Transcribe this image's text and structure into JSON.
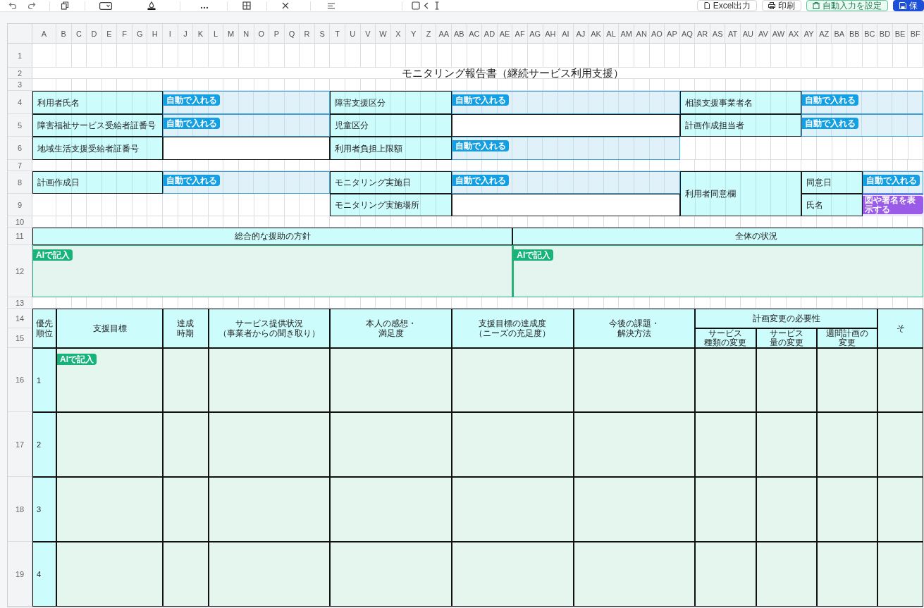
{
  "toolbar": {
    "buttons": [
      {
        "kind": "outline",
        "label": "Excel出力"
      },
      {
        "kind": "outline",
        "label": "印刷"
      },
      {
        "kind": "accent",
        "label": "自動入力を設定"
      },
      {
        "kind": "primary",
        "label": "保"
      }
    ]
  },
  "sheet": {
    "column_headers": [
      "A",
      "B",
      "C",
      "D",
      "E",
      "F",
      "G",
      "H",
      "I",
      "J",
      "K",
      "L",
      "M",
      "N",
      "O",
      "P",
      "Q",
      "R",
      "S",
      "T",
      "U",
      "V",
      "W",
      "X",
      "Y",
      "Z",
      "AA",
      "AB",
      "AC",
      "AD",
      "AE",
      "AF",
      "AG",
      "AH",
      "AI",
      "AJ",
      "AK",
      "AL",
      "AM",
      "AN",
      "AO",
      "AP",
      "AQ",
      "AR",
      "AS",
      "AT",
      "AU",
      "AV",
      "AW",
      "AX",
      "AY",
      "AZ",
      "BA",
      "BB",
      "BC",
      "BD",
      "BE",
      "BF"
    ],
    "row_headers": [
      "1",
      "2",
      "3",
      "4",
      "5",
      "6",
      "7",
      "8",
      "9",
      "10",
      "11",
      "12",
      "13",
      "14",
      "15",
      "16",
      "17",
      "18",
      "19"
    ],
    "title": "モニタリング報告書（継続サービス利用支援）",
    "info_rows": [
      [
        {
          "kind": "label",
          "text": "利用者氏名"
        },
        {
          "kind": "auto",
          "button": "自動で入れる"
        },
        {
          "kind": "label",
          "text": "障害支援区分"
        },
        {
          "kind": "auto",
          "button": "自動で入れる"
        },
        {
          "kind": "label",
          "text": "相談支援事業者名"
        },
        {
          "kind": "auto",
          "button": "自動で入れる"
        }
      ],
      [
        {
          "kind": "label",
          "text": "障害福祉サービス受給者証番号"
        },
        {
          "kind": "auto",
          "button": "自動で入れる"
        },
        {
          "kind": "label",
          "text": "児童区分"
        },
        {
          "kind": "blank"
        },
        {
          "kind": "label",
          "text": "計画作成担当者"
        },
        {
          "kind": "auto",
          "button": "自動で入れる"
        }
      ],
      [
        {
          "kind": "label",
          "text": "地域生活支援受給者証番号"
        },
        {
          "kind": "blank"
        },
        {
          "kind": "label",
          "text": "利用者負担上限額"
        },
        {
          "kind": "auto",
          "button": "自動で入れる"
        }
      ],
      [
        {
          "kind": "label",
          "text": "計画作成日"
        },
        {
          "kind": "auto",
          "button": "自動で入れる"
        },
        {
          "kind": "label",
          "text": "モニタリング実施日"
        },
        {
          "kind": "auto",
          "button": "自動で入れる"
        },
        {
          "kind": "label",
          "text": "利用者同意欄"
        },
        {
          "kind": "label",
          "text": "同意日"
        },
        {
          "kind": "auto",
          "button": "自動で入れる"
        }
      ],
      [
        {
          "kind": "label",
          "text": "モニタリング実施場所"
        },
        {
          "kind": "blank"
        },
        {
          "kind": "label",
          "text": "氏名"
        },
        {
          "kind": "signature",
          "button": "図や署名を表示する"
        }
      ]
    ],
    "summary_sections": [
      {
        "title": "総合的な援助の方針",
        "button": "AIで記入"
      },
      {
        "title": "全体の状況",
        "button": "AIで記入"
      }
    ],
    "support_table": {
      "columns": [
        {
          "title": "優先順位"
        },
        {
          "title": "支援目標"
        },
        {
          "title": "達成時期"
        },
        {
          "title": "サービス提供状況（事業者からの聞き取り）"
        },
        {
          "title": "本人の感想・満足度"
        },
        {
          "title": "支援目標の達成度（ニーズの充足度）"
        },
        {
          "title": "今後の課題・解決方法"
        },
        {
          "title": "計画変更の必要性",
          "children": [
            {
              "title": "サービス種類の変更"
            },
            {
              "title": "サービス量の変更"
            },
            {
              "title": "週間計画の変更"
            }
          ]
        },
        {
          "title": "そ"
        }
      ],
      "rows": [
        {
          "priority": "1",
          "button": "AIで記入"
        },
        {
          "priority": "2"
        },
        {
          "priority": "3"
        },
        {
          "priority": "4"
        }
      ]
    }
  }
}
